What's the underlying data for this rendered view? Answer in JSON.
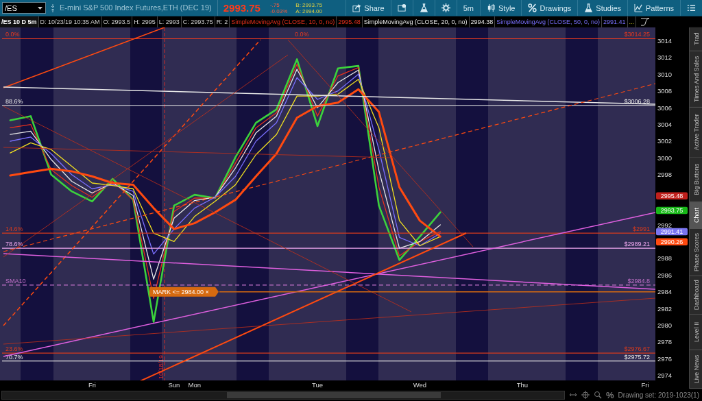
{
  "toolbar": {
    "symbol": "/ES",
    "description": "E-mini S&P 500 Index Futures,ETH (DEC 19)",
    "last": "2993.75",
    "change": "-.75",
    "change_pct": "-0.03%",
    "bid": "B: 2993.75",
    "ask": "A: 2994.00",
    "buttons": [
      {
        "kind": "share",
        "label": "Share"
      },
      {
        "kind": "message"
      },
      {
        "kind": "flask"
      },
      {
        "kind": "gear"
      },
      {
        "kind": "text",
        "label": "5m"
      },
      {
        "kind": "style",
        "label": "Style"
      },
      {
        "kind": "drawings",
        "label": "Drawings"
      },
      {
        "kind": "studies",
        "label": "Studies"
      },
      {
        "kind": "patterns",
        "label": "Patterns"
      },
      {
        "kind": "menu"
      }
    ]
  },
  "info_bar": {
    "header": "/ES 10 D 5m",
    "fields": [
      "D: 10/23/19 10:35 AM",
      "O: 2993.5",
      "H: 2995",
      "L: 2993",
      "C: 2993.75",
      "R: 2"
    ],
    "studies": [
      {
        "label": "SimpleMovingAvg (CLOSE, 10, 0, no)",
        "value": "2995.48"
      },
      {
        "label": "SimpleMovingAvg (CLOSE, 20, 0, no)",
        "value": "2994.38"
      },
      {
        "label": "SimpleMovingAvg (CLOSE, 50, 0, no)",
        "value": "2991.41"
      }
    ],
    "more": "..."
  },
  "chart": {
    "chart_data": {
      "type": "line",
      "ylim": [
        2973.4,
        3015.6
      ],
      "yticks": [
        2974,
        2976,
        2978,
        2980,
        2982,
        2984,
        2986,
        2988,
        2992,
        2998,
        3000,
        3002,
        3004,
        3006,
        3008,
        3010,
        3012,
        3014
      ],
      "categories": [
        null,
        null,
        null,
        null,
        "Fri",
        null,
        null,
        null,
        "Sun",
        "Mon",
        null,
        null,
        null,
        null,
        null,
        "Tue",
        null,
        null,
        null,
        null,
        "Wed",
        null,
        null,
        null,
        null,
        "Thu",
        null,
        null,
        null,
        null,
        null,
        "Fri"
      ],
      "series": [
        {
          "color": "#3cd23c",
          "values": [
            3004.5,
            3005.0,
            2998.0,
            2996.0,
            2994.8,
            2997.5,
            2995.0,
            2980.4,
            2994.3,
            2995.6,
            2995.2,
            3000.1,
            3004.2,
            3005.8,
            3011.8,
            3003.8,
            3010.7,
            3011.0,
            2994.3,
            2987.8,
            2990.6,
            2993.5,
            null,
            null,
            null,
            null,
            null,
            null,
            null,
            null,
            null,
            null
          ]
        },
        {
          "color": "#e8301c",
          "values": [
            3003.6,
            3004.0,
            2998.6,
            2996.7,
            2995.3,
            2997.2,
            2995.0,
            2983.2,
            2993.6,
            2995.2,
            2995.2,
            2999.4,
            3003.6,
            3005.4,
            3011.2,
            3005.0,
            3009.8,
            3010.8,
            2996.5,
            2988.3,
            2990.0,
            2991.2,
            null,
            null,
            null,
            null,
            null,
            null,
            null,
            null,
            null,
            null
          ]
        },
        {
          "color": "#e8e8e8",
          "values": [
            3002.8,
            3003.2,
            2999.8,
            2997.2,
            2995.8,
            2997.0,
            2995.5,
            2985.5,
            2992.8,
            2994.9,
            2995.3,
            2998.8,
            3003.0,
            3005.0,
            3010.6,
            3006.0,
            3009.0,
            3010.5,
            2998.5,
            2989.2,
            2990.0,
            2992.0,
            null,
            null,
            null,
            null,
            null,
            null,
            null,
            null,
            null,
            null
          ]
        },
        {
          "color": "#7a70ff",
          "values": [
            3002.0,
            3002.5,
            3000.5,
            2998.0,
            2996.3,
            2996.8,
            2996.0,
            2988.5,
            2991.5,
            2994.0,
            2995.3,
            2997.8,
            3002.0,
            3004.2,
            3009.6,
            3007.0,
            3008.0,
            3010.0,
            3001.0,
            2990.5,
            2989.5,
            2991.0,
            null,
            null,
            null,
            null,
            null,
            null,
            null,
            null,
            null,
            null
          ]
        },
        {
          "color": "#f0e020",
          "values": [
            3000.6,
            3001.8,
            3001.0,
            2999.0,
            2997.0,
            2996.7,
            2996.3,
            2991.0,
            2990.0,
            2993.0,
            2994.8,
            2996.8,
            3000.4,
            3002.8,
            3007.4,
            3007.4,
            3007.6,
            3009.4,
            3003.6,
            2992.5,
            2989.5,
            2990.6,
            null,
            null,
            null,
            null,
            null,
            null,
            null,
            null,
            null,
            null
          ]
        },
        {
          "color": "#ff4a10",
          "values": [
            2997.9,
            2998.3,
            2998.7,
            2998.4,
            2997.8,
            2997.0,
            2996.8,
            2994.0,
            2991.5,
            2992.2,
            2993.5,
            2995.0,
            2997.8,
            3000.5,
            3004.8,
            3006.2,
            3006.6,
            3008.2,
            3005.5,
            2996.5,
            2992.5,
            2990.6,
            null,
            null,
            null,
            null,
            null,
            null,
            null,
            null,
            null,
            null
          ]
        }
      ],
      "ref_lines": [
        {
          "axis": "y",
          "value": 3014.25,
          "label": "$3014.25"
        },
        {
          "axis": "y",
          "value": 3006.28,
          "label": "$3006.28"
        },
        {
          "axis": "y",
          "value": 2991,
          "label": "$2991"
        },
        {
          "axis": "y",
          "value": 2989.21,
          "label": "$2989.21"
        },
        {
          "axis": "y",
          "value": 2984.8,
          "label": "$2984.8"
        },
        {
          "axis": "y",
          "value": 2976.67,
          "label": "$2976.67"
        },
        {
          "axis": "y",
          "value": 2975.72,
          "label": "$2975.72"
        }
      ],
      "annotations": [
        "0.0%",
        "0.0%",
        "88.6%",
        "14.6%",
        "78.6%",
        "SMA10",
        "23.6%",
        "70.7%"
      ]
    }
  },
  "alert": {
    "label": "MARK <= 2984.00 ×"
  },
  "date_marker": {
    "label": "10/18/19"
  },
  "price_tags": [
    {
      "label": "2995.48",
      "color": "#c0201c"
    },
    {
      "label": "2993.75",
      "color": "#18b818"
    },
    {
      "label": "2991.41",
      "color": "#7a74f0"
    },
    {
      "label": "2990.26",
      "color": "#ff4a10"
    }
  ],
  "side_tabs": [
    {
      "label": "Trad",
      "selected": false
    },
    {
      "label": "Times And Sales",
      "selected": false
    },
    {
      "label": "Active Trader",
      "selected": false
    },
    {
      "label": "Big Buttons",
      "selected": false
    },
    {
      "label": "Chart",
      "selected": true
    },
    {
      "label": "Phase Scores",
      "selected": false
    },
    {
      "label": "Dashboard",
      "selected": false
    },
    {
      "label": "Level II",
      "selected": false
    },
    {
      "label": "Live News",
      "selected": false
    }
  ],
  "bottom_bar": {
    "percent": "%",
    "drawing_set": "Drawing set: 2019-1023(1)"
  }
}
